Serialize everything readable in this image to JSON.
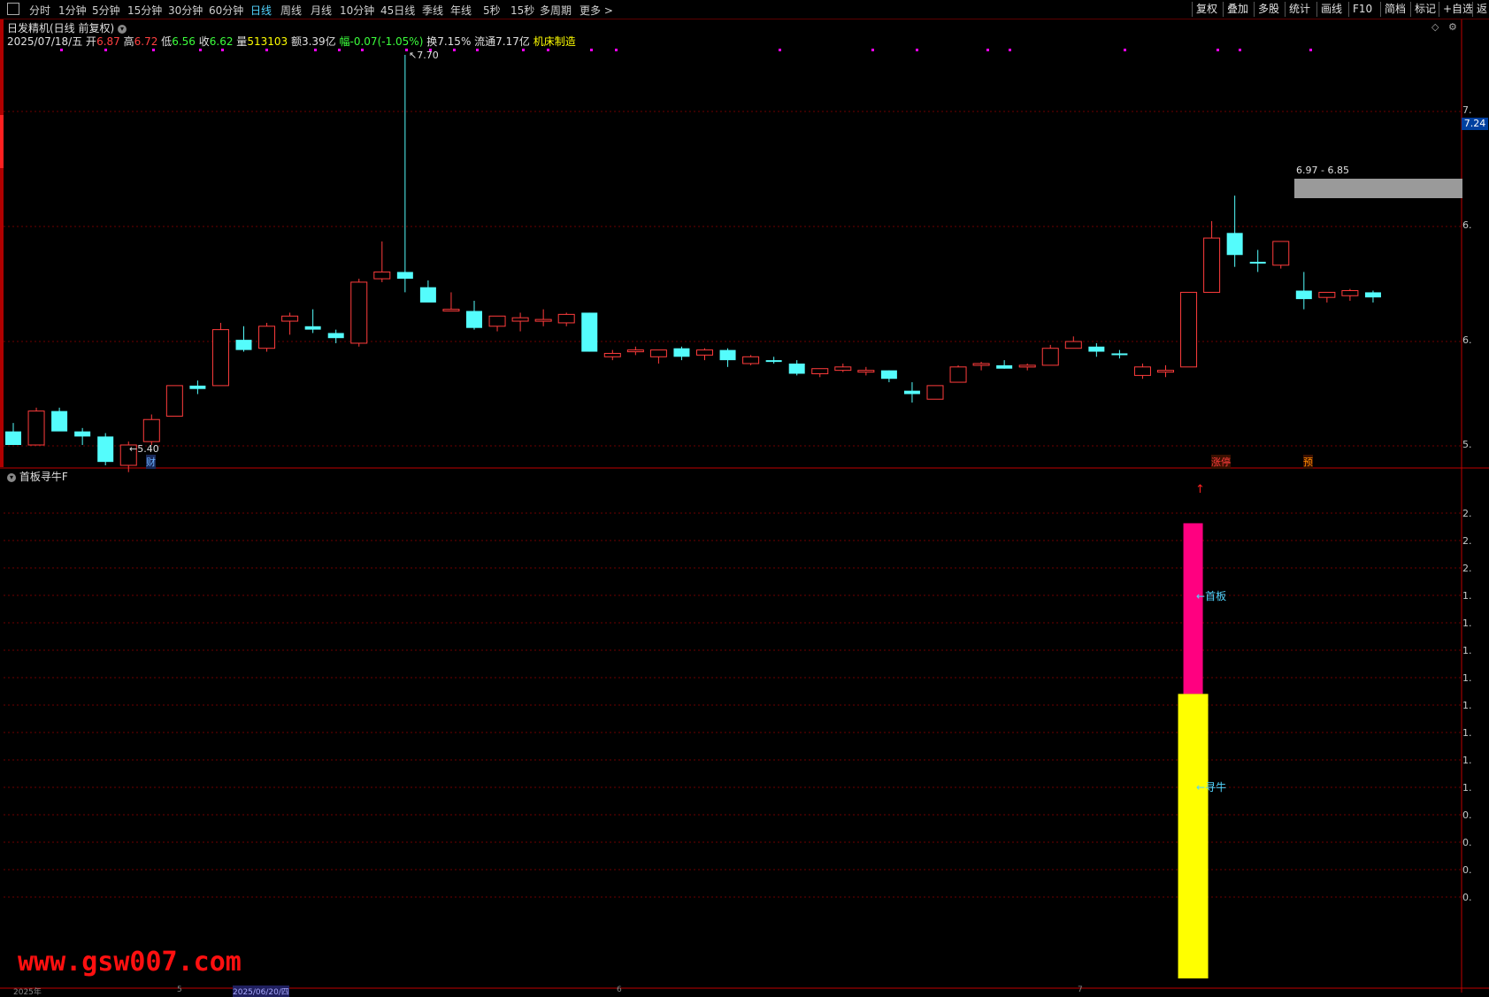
{
  "toolbar": {
    "periods": [
      "分时",
      "1分钟",
      "5分钟",
      "15分钟",
      "30分钟",
      "60分钟",
      "日线",
      "周线",
      "月线",
      "10分钟",
      "45日线",
      "季线",
      "年线",
      "5秒",
      "15秒",
      "多周期",
      "更多 >"
    ],
    "active_period": "日线",
    "right_buttons": [
      "复权",
      "叠加",
      "多股",
      "统计",
      "画线",
      "F10",
      "简档",
      "标记",
      "+自选",
      "返"
    ]
  },
  "header": {
    "title": "日发精机(日线 前复权)",
    "date": "2025/07/18/五",
    "open_label": "开",
    "open": "6.87",
    "high_label": "高",
    "high": "6.72",
    "low_label": "低",
    "low": "6.56",
    "close_label": "收",
    "close": "6.62",
    "volume_label": "量",
    "volume": "513103",
    "amount": "额3.39亿",
    "change": "幅-0.07(-1.05%)",
    "turnover": "换7.15%",
    "float": "流通7.17亿",
    "sector": "机床制造"
  },
  "annotations": {
    "high_mark": "7.70",
    "low_mark": "5.40",
    "range_box": "6.97 - 6.85",
    "price_tag": "7.24",
    "event_cai": "财",
    "event_zhangting": "涨停",
    "event_yu": "预"
  },
  "price_scale": [
    "7.",
    "6.",
    "6.",
    "5."
  ],
  "indicator": {
    "title": "首板寻牛F",
    "label_shouban": "首板",
    "label_xunniu": "寻牛",
    "scale": [
      "2.",
      "2.",
      "2.",
      "1.",
      "1.",
      "1.",
      "1.",
      "1.",
      "1.",
      "1.",
      "1.",
      "0.",
      "0.",
      "0.",
      "0."
    ]
  },
  "colors": {
    "up": "#ff3c3c",
    "down": "#54fcfc",
    "shouban_bar": "#ff0080",
    "xunniu_bar": "#ffff00",
    "grid": "#6e0000",
    "watermark": "#ff1010"
  },
  "watermark": "www.gsw007.com",
  "bottom_axis": [
    "2025年",
    "5",
    "2025/06/20/四",
    "6",
    "7"
  ],
  "chart_data": {
    "type": "candlestick",
    "note_units": "price",
    "candles": [
      {
        "o": 5.48,
        "h": 5.53,
        "l": 5.4,
        "c": 5.4
      },
      {
        "o": 5.4,
        "h": 5.62,
        "l": 5.4,
        "c": 5.6
      },
      {
        "o": 5.6,
        "h": 5.62,
        "l": 5.5,
        "c": 5.48
      },
      {
        "o": 5.48,
        "h": 5.5,
        "l": 5.4,
        "c": 5.45
      },
      {
        "o": 5.45,
        "h": 5.47,
        "l": 5.28,
        "c": 5.3
      },
      {
        "o": 5.28,
        "h": 5.42,
        "l": 5.24,
        "c": 5.4
      },
      {
        "o": 5.42,
        "h": 5.58,
        "l": 5.4,
        "c": 5.55
      },
      {
        "o": 5.57,
        "h": 5.75,
        "l": 5.57,
        "c": 5.75
      },
      {
        "o": 5.75,
        "h": 5.78,
        "l": 5.7,
        "c": 5.73
      },
      {
        "o": 5.75,
        "h": 6.12,
        "l": 5.75,
        "c": 6.08
      },
      {
        "o": 6.02,
        "h": 6.1,
        "l": 5.95,
        "c": 5.96
      },
      {
        "o": 5.97,
        "h": 6.12,
        "l": 5.95,
        "c": 6.1
      },
      {
        "o": 6.13,
        "h": 6.18,
        "l": 6.05,
        "c": 6.16
      },
      {
        "o": 6.1,
        "h": 6.2,
        "l": 6.06,
        "c": 6.08
      },
      {
        "o": 6.06,
        "h": 6.08,
        "l": 6.0,
        "c": 6.03
      },
      {
        "o": 6.0,
        "h": 6.38,
        "l": 5.98,
        "c": 6.36
      },
      {
        "o": 6.38,
        "h": 6.6,
        "l": 6.36,
        "c": 6.42
      },
      {
        "o": 6.42,
        "h": 7.7,
        "l": 6.3,
        "c": 6.38
      },
      {
        "o": 6.33,
        "h": 6.37,
        "l": 6.25,
        "c": 6.24
      },
      {
        "o": 6.2,
        "h": 6.3,
        "l": 6.2,
        "c": 6.2
      },
      {
        "o": 6.19,
        "h": 6.25,
        "l": 6.08,
        "c": 6.09
      },
      {
        "o": 6.1,
        "h": 6.16,
        "l": 6.07,
        "c": 6.16
      },
      {
        "o": 6.13,
        "h": 6.18,
        "l": 6.07,
        "c": 6.15
      },
      {
        "o": 6.13,
        "h": 6.2,
        "l": 6.1,
        "c": 6.14
      },
      {
        "o": 6.12,
        "h": 6.18,
        "l": 6.1,
        "c": 6.17
      },
      {
        "o": 6.18,
        "h": 6.18,
        "l": 5.95,
        "c": 5.95
      },
      {
        "o": 5.92,
        "h": 5.96,
        "l": 5.9,
        "c": 5.94
      },
      {
        "o": 5.95,
        "h": 5.98,
        "l": 5.93,
        "c": 5.96
      },
      {
        "o": 5.92,
        "h": 5.96,
        "l": 5.88,
        "c": 5.96
      },
      {
        "o": 5.97,
        "h": 5.98,
        "l": 5.9,
        "c": 5.92
      },
      {
        "o": 5.93,
        "h": 5.97,
        "l": 5.9,
        "c": 5.96
      },
      {
        "o": 5.96,
        "h": 5.97,
        "l": 5.86,
        "c": 5.9
      },
      {
        "o": 5.88,
        "h": 5.93,
        "l": 5.87,
        "c": 5.92
      },
      {
        "o": 5.9,
        "h": 5.92,
        "l": 5.88,
        "c": 5.89
      },
      {
        "o": 5.88,
        "h": 5.9,
        "l": 5.81,
        "c": 5.82
      },
      {
        "o": 5.82,
        "h": 5.85,
        "l": 5.8,
        "c": 5.85
      },
      {
        "o": 5.84,
        "h": 5.88,
        "l": 5.83,
        "c": 5.86
      },
      {
        "o": 5.84,
        "h": 5.86,
        "l": 5.81,
        "c": 5.84
      },
      {
        "o": 5.84,
        "h": 5.84,
        "l": 5.77,
        "c": 5.79
      },
      {
        "o": 5.72,
        "h": 5.77,
        "l": 5.65,
        "c": 5.7
      },
      {
        "o": 5.67,
        "h": 5.75,
        "l": 5.67,
        "c": 5.75
      },
      {
        "o": 5.77,
        "h": 5.87,
        "l": 5.77,
        "c": 5.86
      },
      {
        "o": 5.87,
        "h": 5.89,
        "l": 5.84,
        "c": 5.88
      },
      {
        "o": 5.87,
        "h": 5.9,
        "l": 5.85,
        "c": 5.85
      },
      {
        "o": 5.86,
        "h": 5.88,
        "l": 5.84,
        "c": 5.87
      },
      {
        "o": 5.87,
        "h": 5.99,
        "l": 5.87,
        "c": 5.97
      },
      {
        "o": 5.97,
        "h": 6.04,
        "l": 5.97,
        "c": 6.01
      },
      {
        "o": 5.98,
        "h": 6.0,
        "l": 5.92,
        "c": 5.95
      },
      {
        "o": 5.94,
        "h": 5.96,
        "l": 5.91,
        "c": 5.93
      },
      {
        "o": 5.81,
        "h": 5.88,
        "l": 5.79,
        "c": 5.86
      },
      {
        "o": 5.84,
        "h": 5.87,
        "l": 5.8,
        "c": 5.84
      },
      {
        "o": 5.86,
        "h": 6.3,
        "l": 5.86,
        "c": 6.3
      },
      {
        "o": 6.3,
        "h": 6.72,
        "l": 6.3,
        "c": 6.62
      },
      {
        "o": 6.65,
        "h": 6.87,
        "l": 6.45,
        "c": 6.52
      },
      {
        "o": 6.48,
        "h": 6.55,
        "l": 6.42,
        "c": 6.47
      },
      {
        "o": 6.46,
        "h": 6.6,
        "l": 6.44,
        "c": 6.6
      },
      {
        "o": 6.31,
        "h": 6.42,
        "l": 6.2,
        "c": 6.26
      },
      {
        "o": 6.27,
        "h": 6.3,
        "l": 6.24,
        "c": 6.3
      },
      {
        "o": 6.28,
        "h": 6.32,
        "l": 6.25,
        "c": 6.31
      },
      {
        "o": 6.3,
        "h": 6.31,
        "l": 6.24,
        "c": 6.27
      }
    ],
    "indicator_bars": [
      {
        "index": 51,
        "shouban_top": 2.0,
        "xunniu_top": 1.25,
        "base": 0.0
      }
    ]
  }
}
